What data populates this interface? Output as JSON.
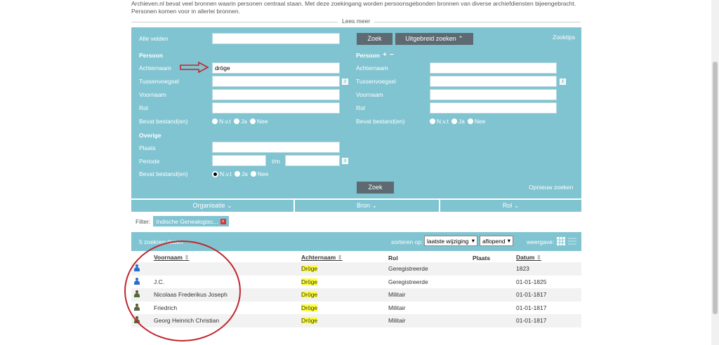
{
  "intro": {
    "line1": "Archieven.nl bevat veel bronnen waarin personen centraal staan. Met deze zoekingang worden persoonsgebonden bronnen van diverse archiefdiensten bijeengebracht.",
    "line2": "Personen komen voor in allerlei bronnen.",
    "lees_meer": "Lees meer"
  },
  "search": {
    "alle_velden_label": "Alle velden",
    "alle_velden_value": "",
    "zoek_label": "Zoek",
    "uitgebreid_label": "Uitgebreid zoeken ⌃",
    "zoektips_label": "Zooktips",
    "person1": {
      "heading": "Persoon",
      "achternaam_label": "Achternaam",
      "achternaam_value": "dröge",
      "tussenvoegsel_label": "Tussenvoegsel",
      "voornaam_label": "Voornaam",
      "rol_label": "Rol",
      "bevat_label": "Bevat bestand(en)"
    },
    "person2": {
      "heading": "Persoon",
      "plus": "+",
      "minus": "−",
      "achternaam_label": "Achternaam",
      "tussenvoegsel_label": "Tussenvoegsel",
      "voornaam_label": "Voornaam",
      "rol_label": "Rol",
      "bevat_label": "Bevat bestand(en)"
    },
    "overige": {
      "heading": "Overige",
      "plaats_label": "Plaats",
      "periode_label": "Periode",
      "tm_label": "t/m",
      "bevat_label": "Bevat bestand(en)"
    },
    "radio": {
      "nvt": "N.v.t",
      "ja": "Ja",
      "nee": "Nee"
    },
    "info_glyph": "i",
    "zoek_bottom_label": "Zoek",
    "opnieuw_label": "Opnieuw zoeken"
  },
  "facets": {
    "organisatie": "Organisatie ⌄",
    "bron": "Bron ⌄",
    "rol": "Rol ⌄"
  },
  "filter": {
    "label": "Filter:",
    "chip": "Indische Genealogisc...",
    "chip_close": "x"
  },
  "results_bar": {
    "count": "5 zoekresultaten",
    "sort_label": "sorteren op:",
    "sort_value": "laatste wijziging",
    "order_value": "aflopend",
    "weergave_label": "weergave:"
  },
  "table": {
    "headers": {
      "voornaam": "Voornaam",
      "achternaam": "Achternaam",
      "rol": "Rol",
      "plaats": "Plaats",
      "datum": "Datum"
    },
    "rows": [
      {
        "icon": "person-blue-icon",
        "voornaam": "",
        "achternaam": "Dröge",
        "rol": "Geregistreerde",
        "plaats": "",
        "datum": "1823"
      },
      {
        "icon": "person-blue-icon",
        "voornaam": "J.C.",
        "achternaam": "Dröge",
        "rol": "Geregistreerde",
        "plaats": "",
        "datum": "01-01-1825"
      },
      {
        "icon": "soldier-icon",
        "voornaam": "Nicolaas Frederikus Joseph",
        "achternaam": "Dröge",
        "rol": "Militair",
        "plaats": "",
        "datum": "01-01-1817"
      },
      {
        "icon": "soldier-icon",
        "voornaam": "Friedrich",
        "achternaam": "Dröge",
        "rol": "Militair",
        "plaats": "",
        "datum": "01-01-1817"
      },
      {
        "icon": "soldier-icon",
        "voornaam": "Georg Heinrich Christian",
        "achternaam": "Dröge",
        "rol": "Militair",
        "plaats": "",
        "datum": "01-01-1817"
      }
    ]
  },
  "colors": {
    "panel": "#80c4d1",
    "button_dark": "#5d6a72",
    "highlight": "#ffff3c",
    "annotation_red": "#c0262d"
  }
}
